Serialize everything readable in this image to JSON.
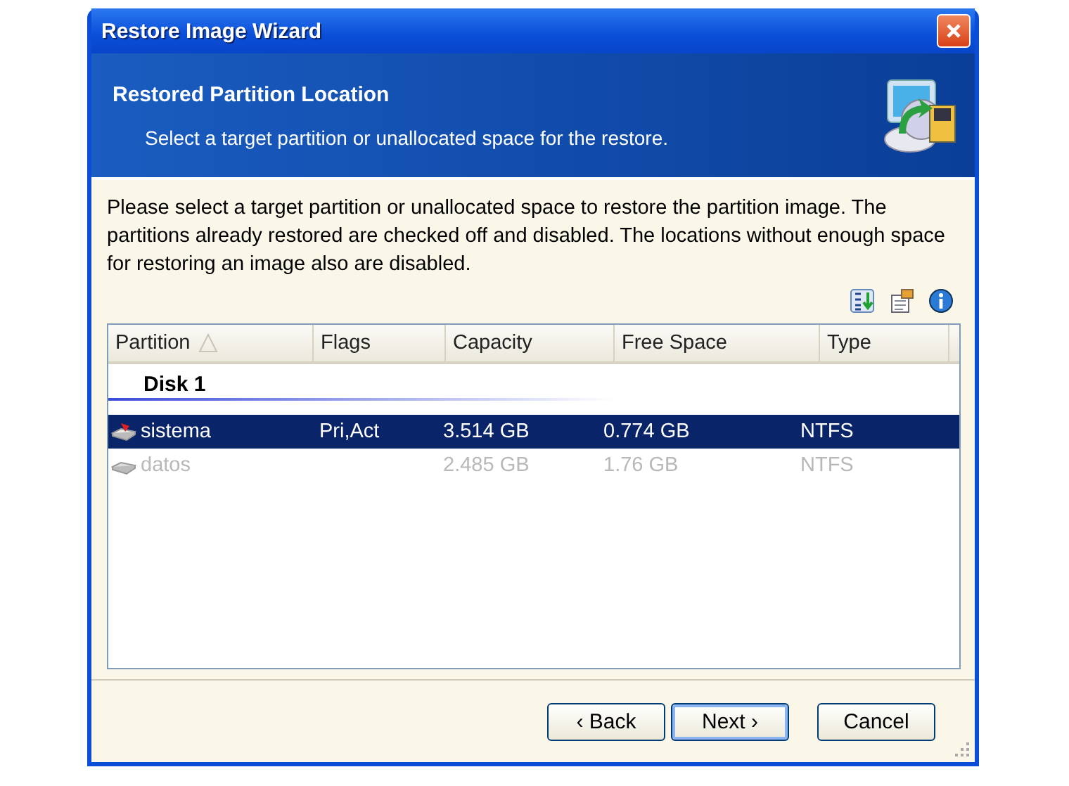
{
  "window": {
    "title": "Restore Image Wizard"
  },
  "header": {
    "title": "Restored Partition Location",
    "subtitle": "Select a target partition or unallocated space for the restore."
  },
  "instructions": "Please select a target partition or unallocated space to restore the partition image. The partitions already restored are checked off and disabled. The locations without enough space for restoring an image also are disabled.",
  "table": {
    "columns": [
      {
        "label": "Partition",
        "sorted": true
      },
      {
        "label": "Flags",
        "sorted": false
      },
      {
        "label": "Capacity",
        "sorted": false
      },
      {
        "label": "Free Space",
        "sorted": false
      },
      {
        "label": "Type",
        "sorted": false
      }
    ],
    "group": "Disk 1",
    "rows": [
      {
        "cells": [
          "sistema",
          "Pri,Act",
          "3.514 GB",
          "0.774 GB",
          "NTFS"
        ],
        "selected": true,
        "disabled": false
      },
      {
        "cells": [
          "datos",
          "",
          "2.485 GB",
          "1.76 GB",
          "NTFS"
        ],
        "selected": false,
        "disabled": true
      }
    ]
  },
  "buttons": [
    {
      "label": "‹ Back"
    },
    {
      "label": "Next ›",
      "default": true
    },
    {
      "label": "Cancel",
      "default": false
    }
  ]
}
